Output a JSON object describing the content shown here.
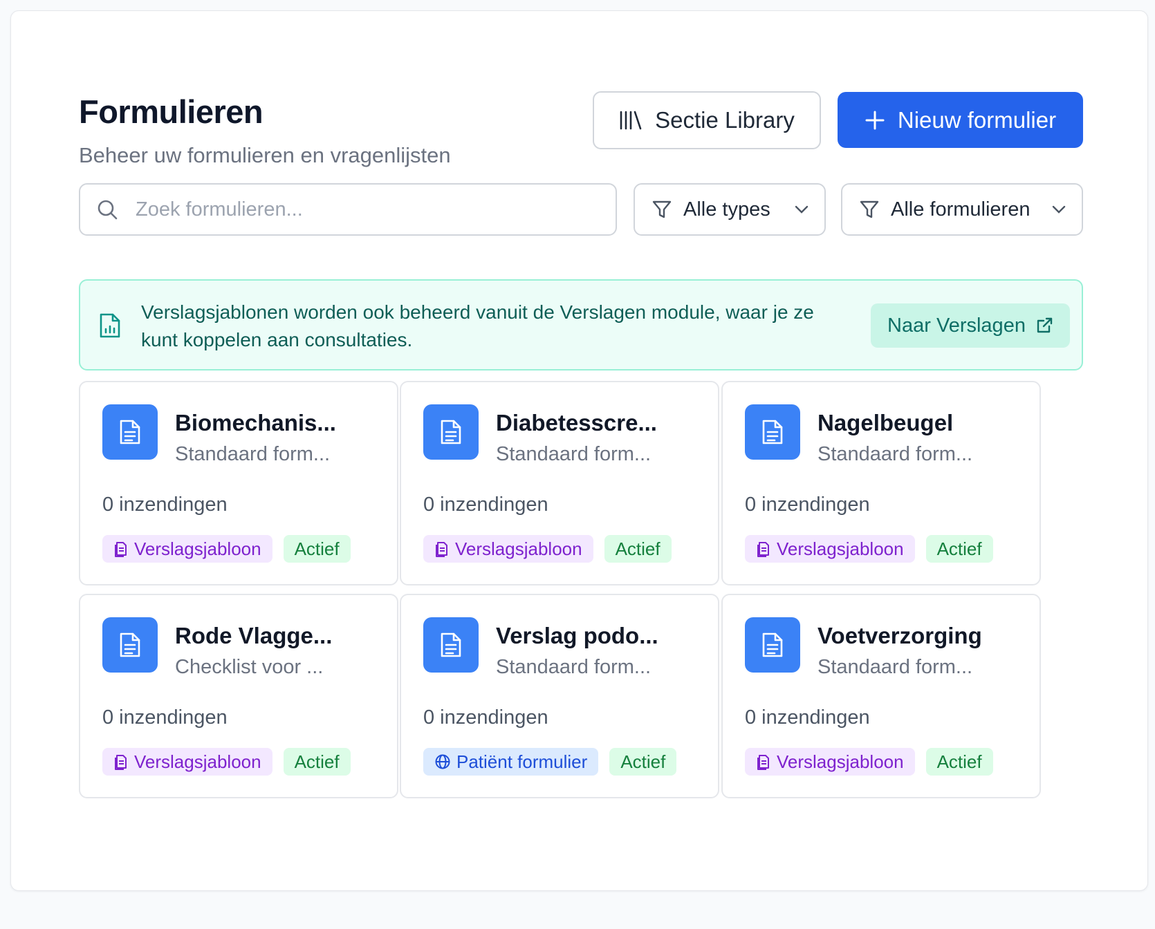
{
  "header": {
    "title": "Formulieren",
    "subtitle": "Beheer uw formulieren en vragenlijsten",
    "library_button": "Sectie Library",
    "new_button": "Nieuw formulier"
  },
  "filters": {
    "search_placeholder": "Zoek formulieren...",
    "search_value": "",
    "type_select": "Alle types",
    "form_select": "Alle formulieren"
  },
  "banner": {
    "text": "Verslagsjablonen worden ook beheerd vanuit de Verslagen module, waar je ze kunt koppelen aan consultaties.",
    "link_label": "Naar Verslagen"
  },
  "colors": {
    "primary": "#2563eb",
    "card_icon": "#3b82f6",
    "banner_bg": "#ecfdf8",
    "tag_purple": "#7e22ce",
    "tag_blue": "#1d4ed8",
    "tag_green": "#15803d"
  },
  "cards": [
    {
      "title": "Biomechanis...",
      "description": "Standaard form...",
      "count": "0 inzendingen",
      "type_label": "Verslagsjabloon",
      "type_icon": "report-template-icon",
      "status": "Actief"
    },
    {
      "title": "Diabetesscre...",
      "description": "Standaard form...",
      "count": "0 inzendingen",
      "type_label": "Verslagsjabloon",
      "type_icon": "report-template-icon",
      "status": "Actief"
    },
    {
      "title": "Nagelbeugel",
      "description": "Standaard form...",
      "count": "0 inzendingen",
      "type_label": "Verslagsjabloon",
      "type_icon": "report-template-icon",
      "status": "Actief"
    },
    {
      "title": "Rode Vlagge...",
      "description": "Checklist voor ...",
      "count": "0 inzendingen",
      "type_label": "Verslagsjabloon",
      "type_icon": "report-template-icon",
      "status": "Actief"
    },
    {
      "title": "Verslag podo...",
      "description": "Standaard form...",
      "count": "0 inzendingen",
      "type_label": "Patiënt formulier",
      "type_icon": "globe-icon",
      "status": "Actief"
    },
    {
      "title": "Voetverzorging",
      "description": "Standaard form...",
      "count": "0 inzendingen",
      "type_label": "Verslagsjabloon",
      "type_icon": "report-template-icon",
      "status": "Actief"
    }
  ]
}
